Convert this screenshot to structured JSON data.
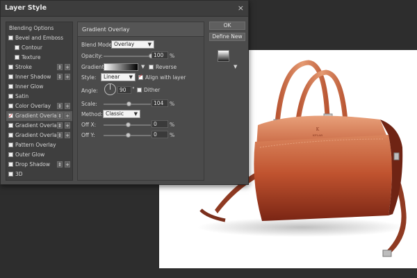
{
  "dialog": {
    "title": "Layer Style",
    "close_glyph": "×"
  },
  "style_list": {
    "items": [
      {
        "label": "Blending Options",
        "checked": false,
        "has_checkbox": false,
        "plus": false
      },
      {
        "label": "Bevel and Emboss",
        "checked": false,
        "has_checkbox": true,
        "plus": false
      },
      {
        "label": "Contour",
        "checked": false,
        "has_checkbox": true,
        "plus": false,
        "indent": true
      },
      {
        "label": "Texture",
        "checked": false,
        "has_checkbox": true,
        "plus": false,
        "indent": true
      },
      {
        "label": "Stroke",
        "checked": false,
        "has_checkbox": true,
        "plus": true
      },
      {
        "label": "Inner Shadow",
        "checked": false,
        "has_checkbox": true,
        "plus": true
      },
      {
        "label": "Inner Glow",
        "checked": false,
        "has_checkbox": true,
        "plus": false
      },
      {
        "label": "Satin",
        "checked": false,
        "has_checkbox": true,
        "plus": false
      },
      {
        "label": "Color Overlay",
        "checked": false,
        "has_checkbox": true,
        "plus": true
      },
      {
        "label": "Gradient Overlay",
        "checked": true,
        "has_checkbox": true,
        "plus": true,
        "selected": true
      },
      {
        "label": "Gradient Overlay",
        "checked": false,
        "has_checkbox": true,
        "plus": true
      },
      {
        "label": "Gradient Overlay",
        "checked": false,
        "has_checkbox": true,
        "plus": true
      },
      {
        "label": "Pattern Overlay",
        "checked": false,
        "has_checkbox": true,
        "plus": false
      },
      {
        "label": "Outer Glow",
        "checked": false,
        "has_checkbox": true,
        "plus": false
      },
      {
        "label": "Drop Shadow",
        "checked": false,
        "has_checkbox": true,
        "plus": true
      },
      {
        "label": "3D",
        "checked": false,
        "has_checkbox": true,
        "plus": false
      }
    ],
    "updown_glyph": "⇕",
    "plus_glyph": "+"
  },
  "panel": {
    "title": "Gradient Overlay",
    "blend_mode_label": "Blend Mode:",
    "blend_mode_value": "Overlay",
    "opacity_label": "Opacity:",
    "opacity_value": "100",
    "opacity_level": 1.0,
    "percent": "%",
    "gradient_label": "Gradient:",
    "reverse_label": "Reverse",
    "style_label": "Style:",
    "style_value": "Linear",
    "align_label": "Align with layer",
    "angle_label": "Angle:",
    "angle_value": "90",
    "degree": "°",
    "dither_label": "Dither",
    "scale_label": "Scale:",
    "scale_value": "104",
    "scale_level": 0.52,
    "method_label": "Method:",
    "method_value": "Classic",
    "offx_label": "Off X:",
    "offx_value": "0",
    "offy_label": "Off Y:",
    "offy_value": "0",
    "offset_level": 0.5
  },
  "buttons": {
    "ok": "OK",
    "define_new": "Define New"
  },
  "colors": {
    "dialog_bg": "#4b4b4b",
    "accent_check": "#d7262c",
    "bag_leather": "#c0532f"
  },
  "photo": {
    "bag_stamp_line1": "K",
    "bag_stamp_line2": "KFLAR"
  }
}
